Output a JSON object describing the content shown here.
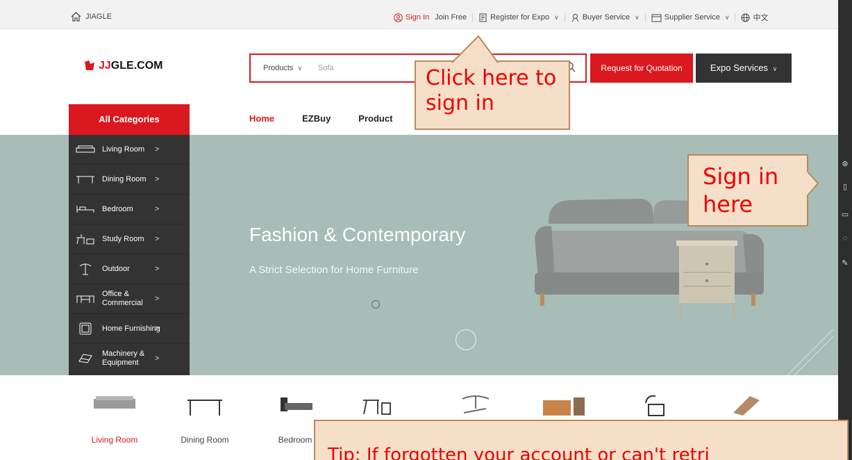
{
  "topbar": {
    "home_label": "JIAGLE",
    "sign_in": "Sign In",
    "join_free": "Join Free",
    "register_expo": "Register for Expo",
    "buyer_service": "Buyer Service",
    "supplier_service": "Supplier Service",
    "language": "中文"
  },
  "header": {
    "logo_prefix": "JJ",
    "logo_suffix": "GLE.COM",
    "search_category": "Products",
    "search_placeholder": "Sofa",
    "rfq_button": "Request for Quotation",
    "expo_button": "Expo Services"
  },
  "nav": {
    "all_categories": "All Categories",
    "tabs": [
      "Home",
      "EZBuy",
      "Product"
    ]
  },
  "sidebar_categories": [
    {
      "label": "Living Room",
      "icon": "sofa-icon"
    },
    {
      "label": "Dining Room",
      "icon": "dining-table-icon"
    },
    {
      "label": "Bedroom",
      "icon": "bed-icon"
    },
    {
      "label": "Study Room",
      "icon": "desk-icon"
    },
    {
      "label": "Outdoor",
      "icon": "umbrella-icon"
    },
    {
      "label": "Office & Commercial",
      "icon": "office-desk-icon"
    },
    {
      "label": "Home Furnishing",
      "icon": "frame-icon"
    },
    {
      "label": "Machinery & Equipment",
      "icon": "machinery-icon"
    }
  ],
  "banner": {
    "title": "Fashion & Contemporary",
    "subtitle": "A Strict Selection for Home Furniture"
  },
  "bottom_categories": [
    "Living Room",
    "Dining Room",
    "Bedroom"
  ],
  "callouts": {
    "signin_top": "Click here to sign in",
    "signin_side": "Sign in here",
    "tip": "Tip: If forgotten your account or can't retri"
  },
  "colors": {
    "brand_red": "#d9181f",
    "banner_bg": "#a8bdb7",
    "menu_dark": "#333333",
    "callout_bg": "#f5dfc8"
  }
}
